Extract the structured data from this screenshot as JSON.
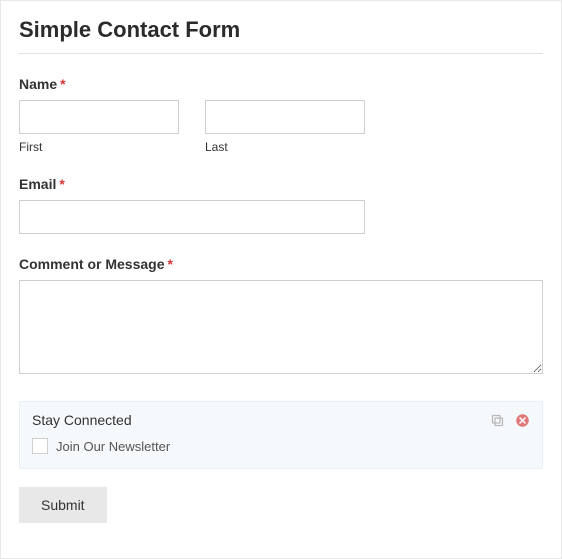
{
  "form": {
    "title": "Simple Contact Form",
    "name": {
      "label": "Name",
      "required_marker": "*",
      "first_sublabel": "First",
      "last_sublabel": "Last",
      "first_value": "",
      "last_value": ""
    },
    "email": {
      "label": "Email",
      "required_marker": "*",
      "value": ""
    },
    "comment": {
      "label": "Comment or Message",
      "required_marker": "*",
      "value": ""
    },
    "checkbox_panel": {
      "title": "Stay Connected",
      "option_label": "Join Our Newsletter"
    },
    "submit_label": "Submit"
  }
}
